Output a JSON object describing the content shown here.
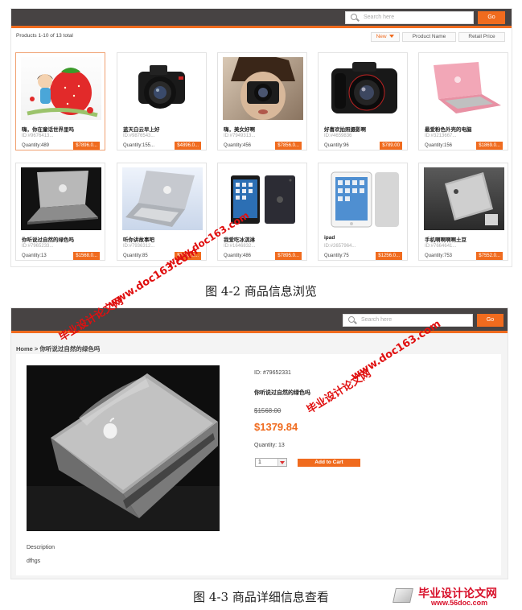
{
  "fig1": {
    "search_placeholder": "Search here",
    "go_label": "Go",
    "list_summary": "Products 1-10 of 13 total",
    "sort": {
      "new_label": "New",
      "name_label": "Product Name",
      "price_label": "Retail Price"
    },
    "products": [
      {
        "name": "嗨，你在童话世界里吗",
        "id": "ID:#9676413...",
        "quantity": "Quantity:489",
        "price": "$7896.0..."
      },
      {
        "name": "蓝天白云早上好",
        "id": "ID:#9876543...",
        "quantity": "Quantity:155...",
        "price": "$4896.0..."
      },
      {
        "name": "嗨，美女好啊",
        "id": "ID:#7949313...",
        "quantity": "Quantity:456",
        "price": "$7856.0..."
      },
      {
        "name": "好喜欢拍照摄影啊",
        "id": "ID:#4659836",
        "quantity": "Quantity:96",
        "price": "$789.00"
      },
      {
        "name": "最爱粉色外壳的电脑",
        "id": "ID:#3213667...",
        "quantity": "Quantity:156",
        "price": "$1869.0..."
      },
      {
        "name": "你听说过自然的绿色吗",
        "id": "ID:#7965233...",
        "quantity": "Quantity:13",
        "price": "$1568.0..."
      },
      {
        "name": "听你讲故事吧",
        "id": "ID:#7936312...",
        "quantity": "Quantity:85",
        "price": "$7568.0..."
      },
      {
        "name": "我爱吃冰淇淋",
        "id": "ID:#1646832...",
        "quantity": "Quantity:486",
        "price": "$7895.0..."
      },
      {
        "name": "ipad",
        "id": "ID:#2657964...",
        "quantity": "Quantity:75",
        "price": "$1256.0..."
      },
      {
        "name": "手机啊啊啊啊土豆",
        "id": "ID:#7664641...",
        "quantity": "Quantity:753",
        "price": "$7552.0..."
      }
    ],
    "caption": "图 4-2   商品信息浏览"
  },
  "fig2": {
    "search_placeholder": "Search here",
    "go_label": "Go",
    "breadcrumb": "Home > 你听说过自然的绿色吗",
    "product_id": "ID: #79652331",
    "product_name": "你听说过自然的绿色吗",
    "old_price": "$1568.00",
    "price": "$1379.84",
    "quantity": "Quantity: 13",
    "qty_value": "1",
    "add_to_cart": "Add to Cart",
    "description_label": "Description",
    "description_text": "dfhgs",
    "caption": "图 4-3   商品详细信息查看"
  },
  "watermarks": {
    "site_cn": "毕业设计论文网",
    "site_url": "www.doc163.com",
    "footer_cn": "毕业设计论文网",
    "footer_url": "www.56doc.com"
  },
  "colors": {
    "accent": "#f06b1e",
    "header": "#474343",
    "watermark": "#e01010"
  }
}
